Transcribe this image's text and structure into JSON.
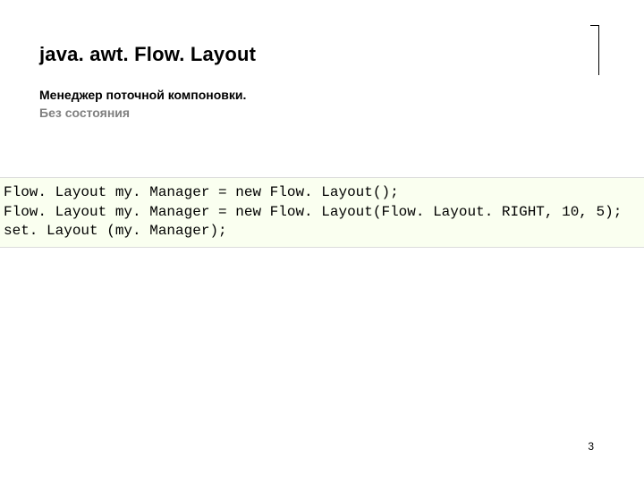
{
  "header": {
    "title": "java. awt. Flow. Layout",
    "subtitle_bold": "Менеджер поточной компоновки.",
    "subtitle_grey": "Без состояния"
  },
  "code": {
    "line1": "Flow. Layout my. Manager = new Flow. Layout();",
    "line2": "Flow. Layout my. Manager = new Flow. Layout(Flow. Layout. RIGHT, 10, 5);",
    "line3": "set. Layout (my. Manager);"
  },
  "footer": {
    "page_number": "3"
  }
}
